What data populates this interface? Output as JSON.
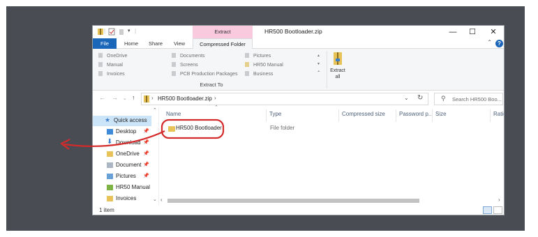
{
  "window": {
    "title": "HR500 Bootloader.zip",
    "context_tab": "Extract",
    "controls": {
      "minimize": "—",
      "maximize": "☐",
      "close": "✕"
    }
  },
  "tabs": {
    "file": "File",
    "home": "Home",
    "share": "Share",
    "view": "View",
    "compressed_folder_tools": "Compressed Folder Tools"
  },
  "ribbon": {
    "destinations_col1": [
      "OneDrive",
      "Manual",
      "Invoices"
    ],
    "destinations_col2": [
      "Documents",
      "Screens",
      "PCB Production Packages"
    ],
    "destinations_col3": [
      "Pictures",
      "HR50 Manual",
      "Business"
    ],
    "group_label": "Extract To",
    "extract_all_line1": "Extract",
    "extract_all_line2": "all"
  },
  "address": {
    "crumb": "HR500 Bootloader.zip",
    "search_placeholder": "Search HR500 Boo..."
  },
  "navpane": {
    "items": [
      {
        "label": "Quick access",
        "icon": "star-icon",
        "pinned": false
      },
      {
        "label": "Desktop",
        "icon": "desktop-icon",
        "pinned": true
      },
      {
        "label": "Download",
        "icon": "download-icon",
        "pinned": true
      },
      {
        "label": "OneDrive",
        "icon": "folder-icon",
        "pinned": true
      },
      {
        "label": "Document",
        "icon": "document-icon",
        "pinned": true
      },
      {
        "label": "Pictures",
        "icon": "pictures-icon",
        "pinned": true
      },
      {
        "label": "HR50 Manual",
        "icon": "folder-icon",
        "pinned": false
      },
      {
        "label": "Invoices",
        "icon": "folder-icon",
        "pinned": false
      }
    ]
  },
  "columns": {
    "name": "Name",
    "type": "Type",
    "compressed_size": "Compressed size",
    "password": "Password p...",
    "size": "Size",
    "ratio": "Ratio"
  },
  "rows": [
    {
      "name": "HR500 Bootloader",
      "type": "File folder"
    }
  ],
  "status": {
    "count": "1 item"
  },
  "colors": {
    "accent": "#1a66b8",
    "context_tab": "#f9c9dd",
    "selection": "#cce4f7",
    "annotation": "#d42a2a",
    "backdrop": "#494c52"
  }
}
